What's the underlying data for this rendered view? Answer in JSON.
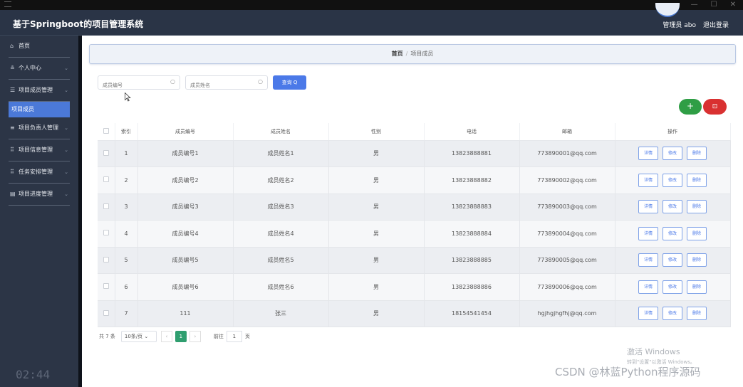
{
  "titlebar": {
    "min": "—",
    "max": "☐",
    "close": "✕"
  },
  "header": {
    "title": "基于Springboot的项目管理系统",
    "admin": "管理员 abo",
    "logout": "退出登录"
  },
  "sidebar": {
    "items": [
      {
        "icon": "⌂",
        "label": "首页",
        "chevron": ""
      },
      {
        "icon": "≗",
        "label": "个人中心",
        "chevron": "⌄"
      },
      {
        "icon": "☰",
        "label": "项目成员管理",
        "chevron": "⌄"
      },
      {
        "icon": "≡",
        "label": "项目负责人管理",
        "chevron": "⌄"
      },
      {
        "icon": "⠿",
        "label": "项目信息管理",
        "chevron": "⌄"
      },
      {
        "icon": "⠿",
        "label": "任务安排管理",
        "chevron": "⌄"
      },
      {
        "icon": "▤",
        "label": "项目进度管理",
        "chevron": "⌄"
      }
    ],
    "active_sub": "项目成员",
    "clock": "02:44"
  },
  "breadcrumb": {
    "home": "首页",
    "sep": "/",
    "current": "项目成员"
  },
  "search": {
    "field1_placeholder": "成员编号",
    "field2_placeholder": "成员姓名",
    "query_label": "查询 Q"
  },
  "actions": {
    "add": "+",
    "delete": "⊡"
  },
  "table": {
    "headers": [
      "",
      "索引",
      "成员编号",
      "成员姓名",
      "性别",
      "电话",
      "邮箱",
      "操作"
    ],
    "op_labels": {
      "detail": "详情",
      "edit": "修改",
      "delete": "删除"
    },
    "rows": [
      {
        "idx": "1",
        "code": "成员编号1",
        "name": "成员姓名1",
        "gender": "男",
        "phone": "13823888881",
        "email": "773890001@qq.com"
      },
      {
        "idx": "2",
        "code": "成员编号2",
        "name": "成员姓名2",
        "gender": "男",
        "phone": "13823888882",
        "email": "773890002@qq.com"
      },
      {
        "idx": "3",
        "code": "成员编号3",
        "name": "成员姓名3",
        "gender": "男",
        "phone": "13823888883",
        "email": "773890003@qq.com"
      },
      {
        "idx": "4",
        "code": "成员编号4",
        "name": "成员姓名4",
        "gender": "男",
        "phone": "13823888884",
        "email": "773890004@qq.com"
      },
      {
        "idx": "5",
        "code": "成员编号5",
        "name": "成员姓名5",
        "gender": "男",
        "phone": "13823888885",
        "email": "773890005@qq.com"
      },
      {
        "idx": "6",
        "code": "成员编号6",
        "name": "成员姓名6",
        "gender": "男",
        "phone": "13823888886",
        "email": "773890006@qq.com"
      },
      {
        "idx": "7",
        "code": "111",
        "name": "张三",
        "gender": "男",
        "phone": "18154541454",
        "email": "hgjhgjhgfhj@qq.com"
      }
    ]
  },
  "pager": {
    "total": "共 7 条",
    "size": "10条/页 ⌄",
    "prev": "‹",
    "current": "1",
    "next": "›",
    "goto_label": "前往",
    "goto_value": "1",
    "page_word": "页"
  },
  "watermarks": {
    "activate": "激活 Windows",
    "activate_sub": "转到\"设置\"以激活 Windows。",
    "csdn": "CSDN @林蓝Python程序源码"
  }
}
